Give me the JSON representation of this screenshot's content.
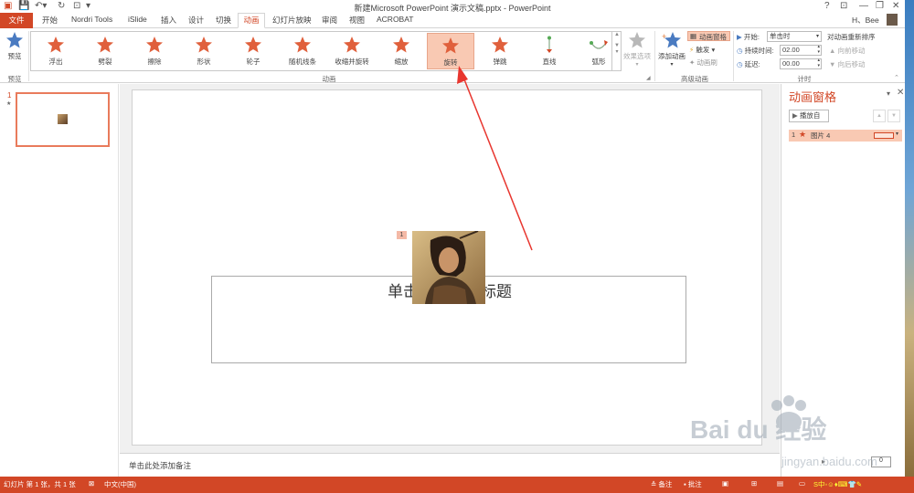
{
  "app": {
    "window_title": "新建Microsoft PowerPoint 演示文稿.pptx - PowerPoint",
    "user": "H、Bee"
  },
  "tabs": [
    "文件",
    "开始",
    "Nordri Tools",
    "iSlide",
    "插入",
    "设计",
    "切换",
    "动画",
    "幻灯片放映",
    "审阅",
    "视图",
    "ACROBAT"
  ],
  "ribbon": {
    "preview": {
      "label": "预览",
      "group": "预览"
    },
    "animations": [
      {
        "label": "浮出",
        "icon": "star-float-icon"
      },
      {
        "label": "劈裂",
        "icon": "star-split-icon"
      },
      {
        "label": "擦除",
        "icon": "star-wipe-icon"
      },
      {
        "label": "形状",
        "icon": "star-shape-icon"
      },
      {
        "label": "轮子",
        "icon": "star-wheel-icon"
      },
      {
        "label": "随机线条",
        "icon": "star-random-bars-icon"
      },
      {
        "label": "收缩并旋转",
        "icon": "star-shrink-turn-icon"
      },
      {
        "label": "缩放",
        "icon": "star-zoom-icon"
      },
      {
        "label": "旋转",
        "icon": "star-spin-icon"
      },
      {
        "label": "弹跳",
        "icon": "star-bounce-icon"
      },
      {
        "label": "直线",
        "icon": "line-path-icon"
      },
      {
        "label": "弧形",
        "icon": "arc-path-icon"
      }
    ],
    "animation_group": "动画",
    "effect_options": "效果选项",
    "add_animation": "添加动画",
    "animation_pane_btn": "动画窗格",
    "trigger": "触发",
    "anim_painter": "动画刷",
    "advanced_group": "高级动画",
    "start_label": "开始:",
    "start_value": "单击时",
    "duration_label": "持续时间:",
    "duration_value": "02.00",
    "delay_label": "延迟:",
    "delay_value": "00.00",
    "reorder_label": "对动画重新排序",
    "move_earlier": "向前移动",
    "move_later": "向后移动",
    "timing_group": "计时",
    "selected": "旋转"
  },
  "slides_pane": {
    "slide_number": "1",
    "star_marker": "★"
  },
  "slide": {
    "title_placeholder": "单击此处添加标题",
    "anim_tag": "1"
  },
  "notes_placeholder": "单击此处添加备注",
  "anim_pane": {
    "title": "动画窗格",
    "play_from": "播放自",
    "items": [
      {
        "index": "1",
        "name": "图片 4"
      }
    ]
  },
  "status": {
    "slide_info": "幻灯片 第 1 张，共 1 张",
    "language": "中文(中国)",
    "notes_btn": "备注",
    "comments_btn": "批注",
    "zoom_box": "0"
  },
  "watermark": {
    "brand": "Bai du 经验",
    "url": "jingyan.baidu.com"
  },
  "colors": {
    "accent": "#d24726",
    "selected": "#f9c9b3",
    "star": "#e0603c",
    "arrow": "#e8362f"
  }
}
